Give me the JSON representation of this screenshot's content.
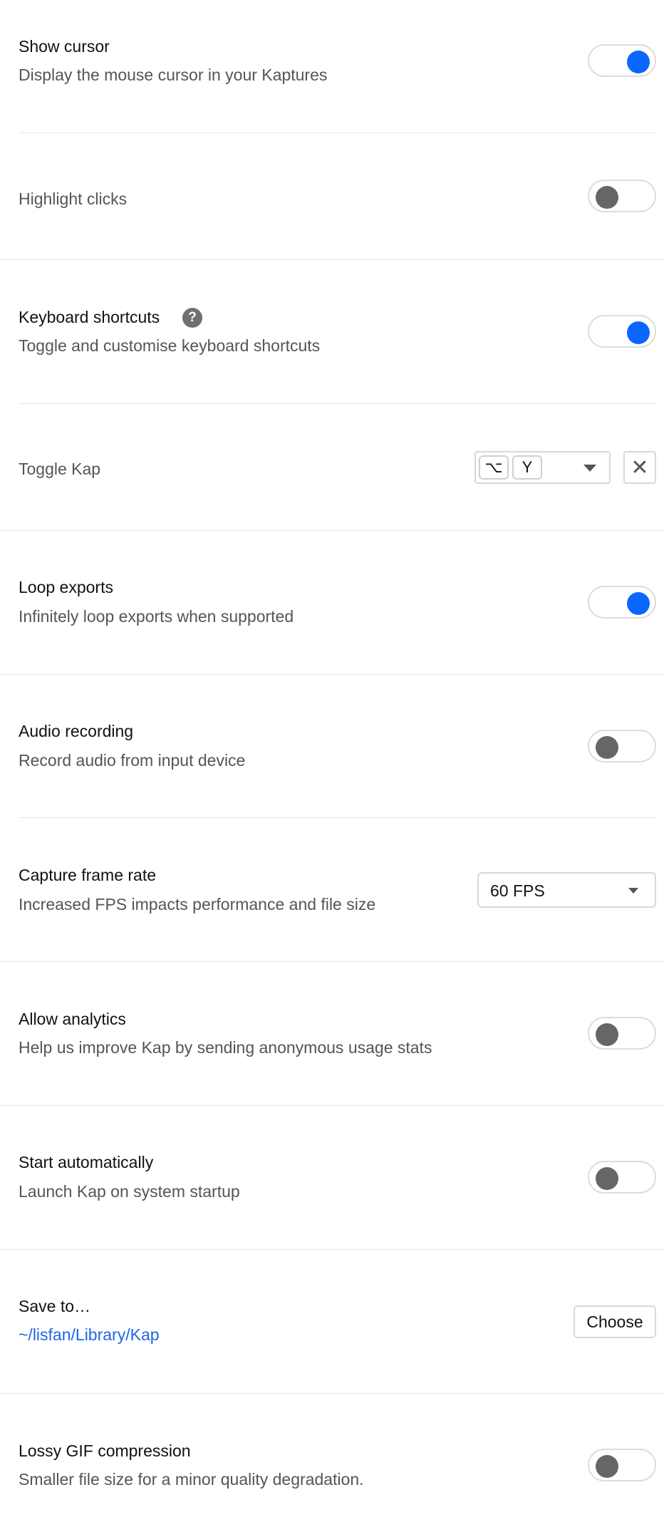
{
  "settings": {
    "show_cursor": {
      "title": "Show cursor",
      "subtitle": "Display the mouse cursor in your Kaptures",
      "enabled": true
    },
    "highlight_clicks": {
      "title": "Highlight clicks",
      "enabled": false
    },
    "keyboard_shortcuts": {
      "title": "Keyboard shortcuts",
      "help_glyph": "?",
      "subtitle": "Toggle and customise keyboard shortcuts",
      "enabled": true
    },
    "toggle_kap": {
      "title": "Toggle Kap",
      "keys": [
        "⌥",
        "Y"
      ],
      "clear_glyph": "✕"
    },
    "loop_exports": {
      "title": "Loop exports",
      "subtitle": "Infinitely loop exports when supported",
      "enabled": true
    },
    "audio_recording": {
      "title": "Audio recording",
      "subtitle": "Record audio from input device",
      "enabled": false
    },
    "capture_frame_rate": {
      "title": "Capture frame rate",
      "subtitle": "Increased FPS impacts performance and file size",
      "selected": "60 FPS"
    },
    "allow_analytics": {
      "title": "Allow analytics",
      "subtitle": "Help us improve Kap by sending anonymous usage stats",
      "enabled": false
    },
    "start_automatically": {
      "title": "Start automatically",
      "subtitle": "Launch Kap on system startup",
      "enabled": false
    },
    "save_to": {
      "title": "Save to…",
      "path": "~/lisfan/Library/Kap",
      "button_label": "Choose"
    },
    "lossy_gif": {
      "title": "Lossy GIF compression",
      "subtitle": "Smaller file size for a minor quality degradation.",
      "enabled": false
    }
  },
  "colors": {
    "accent": "#0a66ff",
    "toggle_off_knob": "#666666",
    "link": "#1f66e5",
    "divider": "#e6e6e6"
  }
}
